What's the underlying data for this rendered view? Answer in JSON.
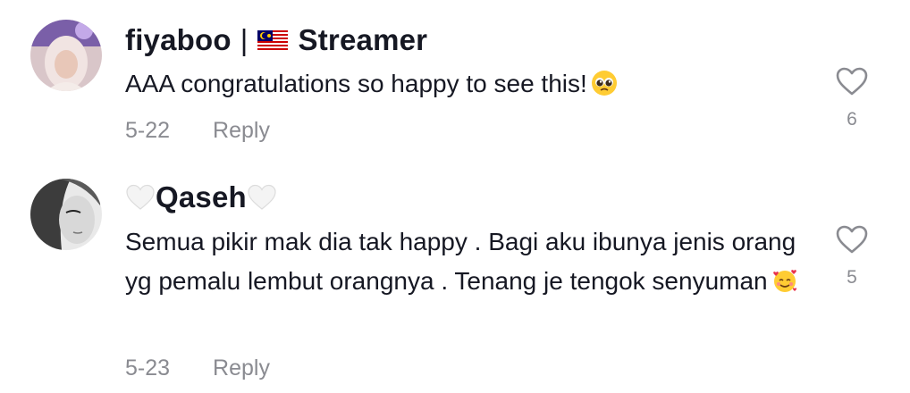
{
  "comments": [
    {
      "username": "fiyaboo",
      "separator": "|",
      "role": "Streamer",
      "text": "AAA congratulations so happy to see this!",
      "text_emoji": "pleading-face-emoji",
      "date": "5-22",
      "reply_label": "Reply",
      "like_count": "6"
    },
    {
      "username": "Qaseh",
      "username_decoration": "white-heart-emoji",
      "text": "Semua pikir mak dia tak happy . Bagi aku ibunya jenis orang yg pemalu lembut orangnya . Tenang je tengok senyuman",
      "text_emoji": "smiling-face-with-hearts-emoji",
      "date": "5-23",
      "reply_label": "Reply",
      "like_count": "5"
    }
  ],
  "colors": {
    "text": "#161823",
    "muted": "#8a8b91",
    "heart_outline": "#8a8b91"
  }
}
